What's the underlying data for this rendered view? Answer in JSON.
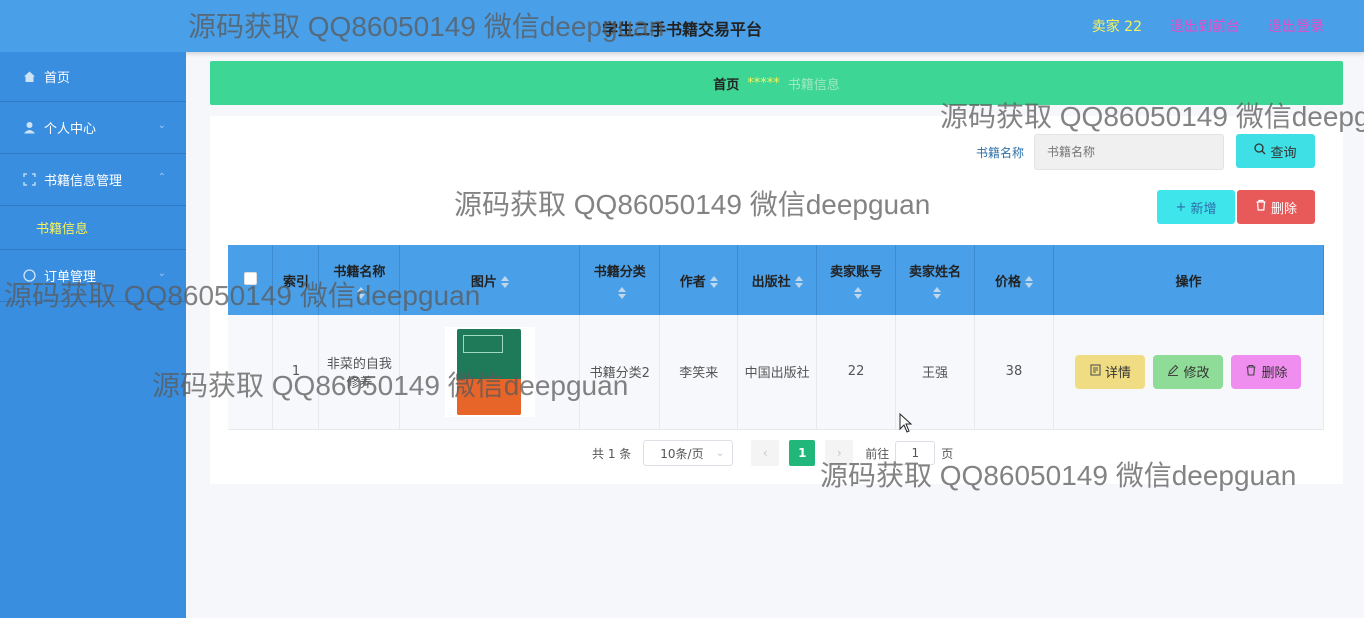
{
  "header": {
    "title": "学生二手书籍交易平台",
    "seller": "卖家 22",
    "front_link": "退出到前台",
    "logout_link": "退出登录"
  },
  "sidebar": {
    "items": [
      {
        "label": "首页",
        "icon": "home-icon"
      },
      {
        "label": "个人中心",
        "icon": "user-icon"
      },
      {
        "label": "书籍信息管理",
        "icon": "expand-icon"
      },
      {
        "sub_label": "书籍信息"
      },
      {
        "label": "订单管理",
        "icon": "circle-icon"
      }
    ]
  },
  "breadcrumb": {
    "home": "首页",
    "separator": "*****",
    "current": "书籍信息"
  },
  "search": {
    "label": "书籍名称",
    "placeholder": "书籍名称",
    "query_label": "查询"
  },
  "actions": {
    "add_label": "新增",
    "delete_label": "删除"
  },
  "table": {
    "headers": [
      "索引",
      "书籍名称",
      "图片",
      "书籍分类",
      "作者",
      "出版社",
      "卖家账号",
      "卖家姓名",
      "价格",
      "操作"
    ],
    "rows": [
      {
        "index": "1",
        "name": "非菜的自我修养",
        "category": "书籍分类2",
        "author": "李笑来",
        "publisher": "中国出版社",
        "seller_account": "22",
        "seller_name": "王强",
        "price": "38"
      }
    ],
    "row_actions": {
      "detail": "详情",
      "edit": "修改",
      "remove": "删除"
    }
  },
  "pagination": {
    "total": "共 1 条",
    "page_size": "10条/页",
    "current_page": "1",
    "goto_label": "前往",
    "goto_value": "1",
    "page_suffix": "页"
  },
  "watermark": "源码获取 QQ86050149 微信deepguan",
  "colors": {
    "header_bg": "#4aa0e8",
    "sidebar_bg": "#3a8ee0",
    "breadcrumb_bg": "#3ed694",
    "accent_yellow": "#f7f25a",
    "link_pink": "#e64bc8"
  }
}
